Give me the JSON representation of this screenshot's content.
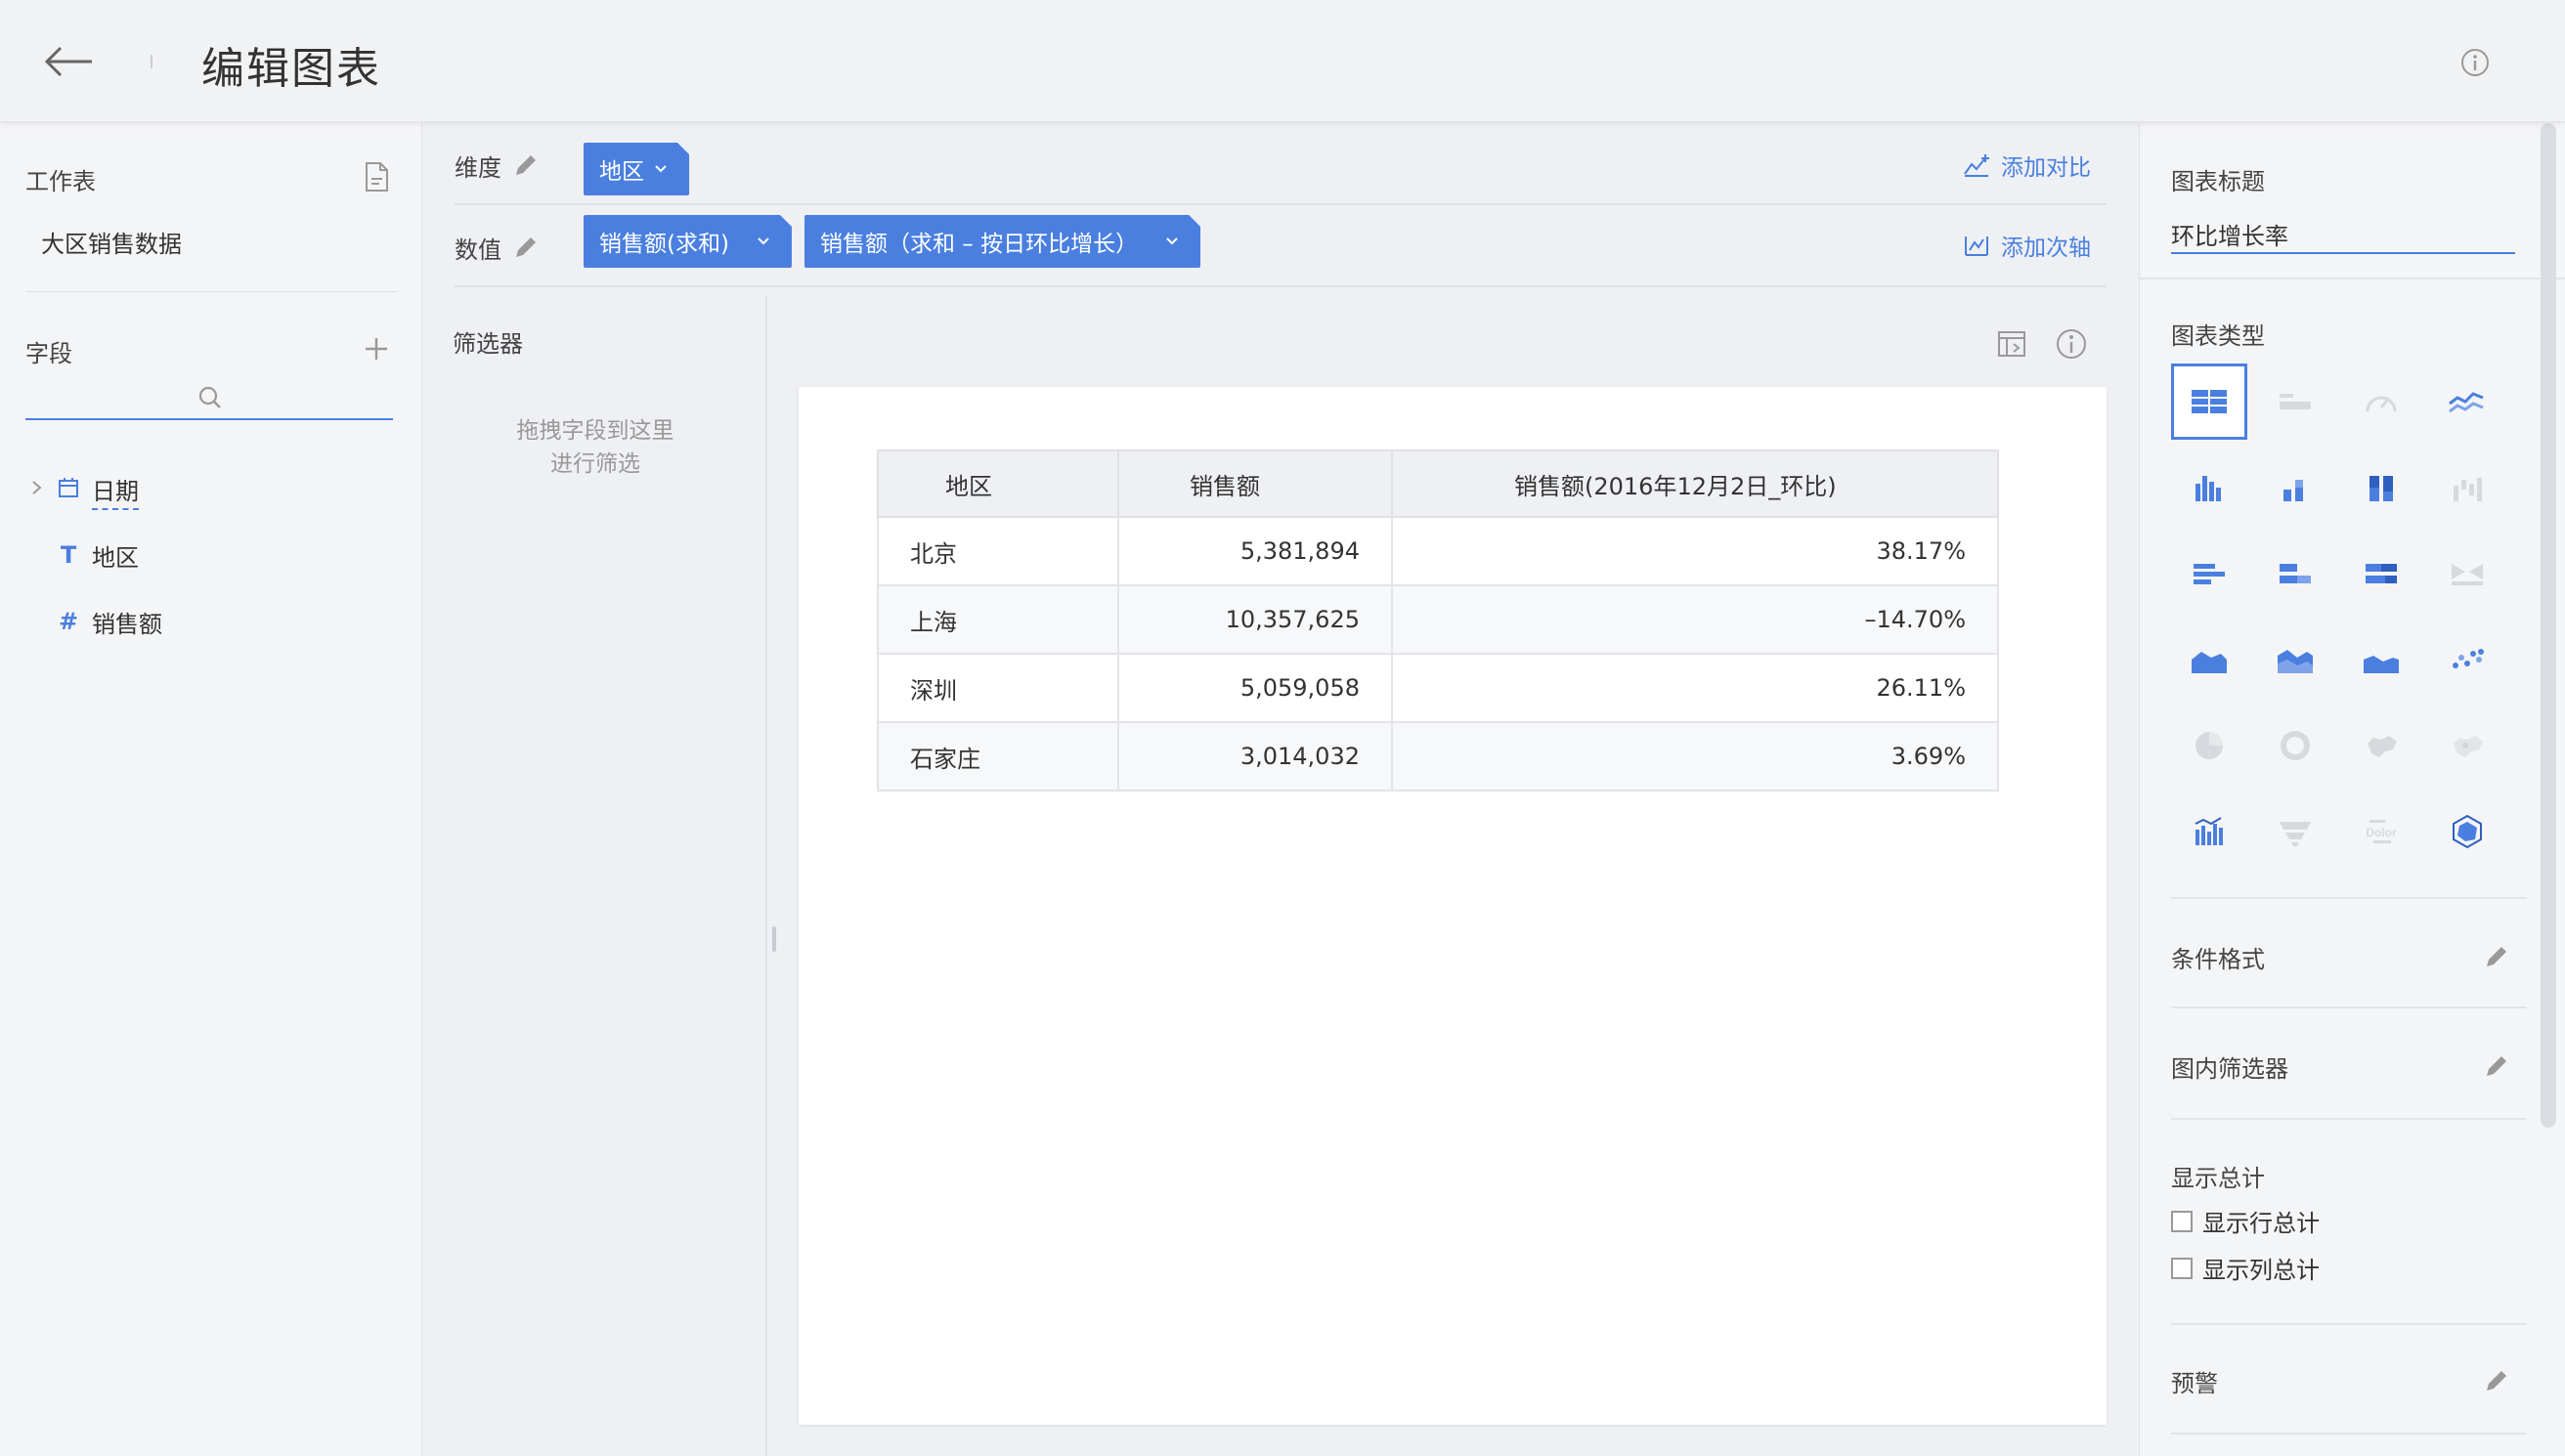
{
  "header": {
    "title": "编辑图表",
    "back_icon": "arrow-left-icon",
    "info_icon": "info-icon"
  },
  "left_panel": {
    "worksheet_label": "工作表",
    "dataset_name": "大区销售数据",
    "fields_label": "字段",
    "search_placeholder": "",
    "fields": [
      {
        "name": "日期",
        "type_icon": "calendar-icon",
        "expandable": true
      },
      {
        "name": "地区",
        "type_icon": "text-type-icon",
        "type_glyph": "T"
      },
      {
        "name": "销售额",
        "type_icon": "number-type-icon",
        "type_glyph": "#"
      }
    ]
  },
  "shelves": {
    "dimension": {
      "label": "维度",
      "pills": [
        "地区"
      ],
      "action": "添加对比"
    },
    "measure": {
      "label": "数值",
      "pills": [
        "销售额(求和)",
        "销售额（求和 – 按日环比增长）"
      ],
      "action": "添加次轴"
    }
  },
  "filter": {
    "title": "筛选器",
    "hint_line1": "拖拽字段到这里",
    "hint_line2": "进行筛选"
  },
  "table": {
    "headers": [
      "地区",
      "销售额",
      "销售额(2016年12月2日_环比)"
    ],
    "rows": [
      [
        "北京",
        "5,381,894",
        "38.17%"
      ],
      [
        "上海",
        "10,357,625",
        "–14.70%"
      ],
      [
        "深圳",
        "5,059,058",
        "26.11%"
      ],
      [
        "石家庄",
        "3,014,032",
        "3.69%"
      ]
    ]
  },
  "right_panel": {
    "chart_title_label": "图表标题",
    "chart_title_value": "环比增长率",
    "chart_type_label": "图表类型",
    "conditional_format": "条件格式",
    "inner_filter": "图内筛选器",
    "show_total": "显示总计",
    "show_row_total": "显示行总计",
    "show_col_total": "显示列总计",
    "alert": "预警",
    "chart_type_icons": [
      "table-chart-icon",
      "kpi-card-icon",
      "gauge-icon",
      "line-chart-icon",
      "column-chart-icon",
      "stacked-column-icon",
      "percent-column-icon",
      "waterfall-icon",
      "bar-chart-icon",
      "stacked-bar-icon",
      "percent-bar-icon",
      "bidirectional-bar-icon",
      "area-chart-icon",
      "stacked-area-icon",
      "percent-area-icon",
      "scatter-icon",
      "pie-chart-icon",
      "ring-chart-icon",
      "map-icon",
      "heat-map-icon",
      "combo-chart-icon",
      "funnel-icon",
      "word-cloud-icon",
      "radar-icon"
    ],
    "word_cloud_text": "Dolor"
  },
  "colors": {
    "accent": "#4a7fe0",
    "header_bg": "#f1f2f4",
    "panel_bg": "#f4f5f7",
    "table_header_bg": "#eef0f3"
  }
}
